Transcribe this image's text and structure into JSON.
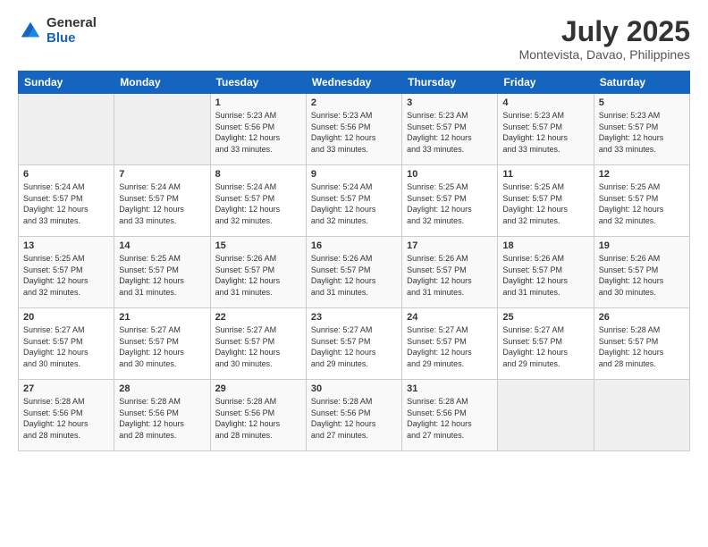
{
  "header": {
    "logo_general": "General",
    "logo_blue": "Blue",
    "title": "July 2025",
    "subtitle": "Montevista, Davao, Philippines"
  },
  "calendar": {
    "days_of_week": [
      "Sunday",
      "Monday",
      "Tuesday",
      "Wednesday",
      "Thursday",
      "Friday",
      "Saturday"
    ],
    "weeks": [
      [
        {
          "day": "",
          "info": ""
        },
        {
          "day": "",
          "info": ""
        },
        {
          "day": "1",
          "info": "Sunrise: 5:23 AM\nSunset: 5:56 PM\nDaylight: 12 hours\nand 33 minutes."
        },
        {
          "day": "2",
          "info": "Sunrise: 5:23 AM\nSunset: 5:56 PM\nDaylight: 12 hours\nand 33 minutes."
        },
        {
          "day": "3",
          "info": "Sunrise: 5:23 AM\nSunset: 5:57 PM\nDaylight: 12 hours\nand 33 minutes."
        },
        {
          "day": "4",
          "info": "Sunrise: 5:23 AM\nSunset: 5:57 PM\nDaylight: 12 hours\nand 33 minutes."
        },
        {
          "day": "5",
          "info": "Sunrise: 5:23 AM\nSunset: 5:57 PM\nDaylight: 12 hours\nand 33 minutes."
        }
      ],
      [
        {
          "day": "6",
          "info": "Sunrise: 5:24 AM\nSunset: 5:57 PM\nDaylight: 12 hours\nand 33 minutes."
        },
        {
          "day": "7",
          "info": "Sunrise: 5:24 AM\nSunset: 5:57 PM\nDaylight: 12 hours\nand 33 minutes."
        },
        {
          "day": "8",
          "info": "Sunrise: 5:24 AM\nSunset: 5:57 PM\nDaylight: 12 hours\nand 32 minutes."
        },
        {
          "day": "9",
          "info": "Sunrise: 5:24 AM\nSunset: 5:57 PM\nDaylight: 12 hours\nand 32 minutes."
        },
        {
          "day": "10",
          "info": "Sunrise: 5:25 AM\nSunset: 5:57 PM\nDaylight: 12 hours\nand 32 minutes."
        },
        {
          "day": "11",
          "info": "Sunrise: 5:25 AM\nSunset: 5:57 PM\nDaylight: 12 hours\nand 32 minutes."
        },
        {
          "day": "12",
          "info": "Sunrise: 5:25 AM\nSunset: 5:57 PM\nDaylight: 12 hours\nand 32 minutes."
        }
      ],
      [
        {
          "day": "13",
          "info": "Sunrise: 5:25 AM\nSunset: 5:57 PM\nDaylight: 12 hours\nand 32 minutes."
        },
        {
          "day": "14",
          "info": "Sunrise: 5:25 AM\nSunset: 5:57 PM\nDaylight: 12 hours\nand 31 minutes."
        },
        {
          "day": "15",
          "info": "Sunrise: 5:26 AM\nSunset: 5:57 PM\nDaylight: 12 hours\nand 31 minutes."
        },
        {
          "day": "16",
          "info": "Sunrise: 5:26 AM\nSunset: 5:57 PM\nDaylight: 12 hours\nand 31 minutes."
        },
        {
          "day": "17",
          "info": "Sunrise: 5:26 AM\nSunset: 5:57 PM\nDaylight: 12 hours\nand 31 minutes."
        },
        {
          "day": "18",
          "info": "Sunrise: 5:26 AM\nSunset: 5:57 PM\nDaylight: 12 hours\nand 31 minutes."
        },
        {
          "day": "19",
          "info": "Sunrise: 5:26 AM\nSunset: 5:57 PM\nDaylight: 12 hours\nand 30 minutes."
        }
      ],
      [
        {
          "day": "20",
          "info": "Sunrise: 5:27 AM\nSunset: 5:57 PM\nDaylight: 12 hours\nand 30 minutes."
        },
        {
          "day": "21",
          "info": "Sunrise: 5:27 AM\nSunset: 5:57 PM\nDaylight: 12 hours\nand 30 minutes."
        },
        {
          "day": "22",
          "info": "Sunrise: 5:27 AM\nSunset: 5:57 PM\nDaylight: 12 hours\nand 30 minutes."
        },
        {
          "day": "23",
          "info": "Sunrise: 5:27 AM\nSunset: 5:57 PM\nDaylight: 12 hours\nand 29 minutes."
        },
        {
          "day": "24",
          "info": "Sunrise: 5:27 AM\nSunset: 5:57 PM\nDaylight: 12 hours\nand 29 minutes."
        },
        {
          "day": "25",
          "info": "Sunrise: 5:27 AM\nSunset: 5:57 PM\nDaylight: 12 hours\nand 29 minutes."
        },
        {
          "day": "26",
          "info": "Sunrise: 5:28 AM\nSunset: 5:57 PM\nDaylight: 12 hours\nand 28 minutes."
        }
      ],
      [
        {
          "day": "27",
          "info": "Sunrise: 5:28 AM\nSunset: 5:56 PM\nDaylight: 12 hours\nand 28 minutes."
        },
        {
          "day": "28",
          "info": "Sunrise: 5:28 AM\nSunset: 5:56 PM\nDaylight: 12 hours\nand 28 minutes."
        },
        {
          "day": "29",
          "info": "Sunrise: 5:28 AM\nSunset: 5:56 PM\nDaylight: 12 hours\nand 28 minutes."
        },
        {
          "day": "30",
          "info": "Sunrise: 5:28 AM\nSunset: 5:56 PM\nDaylight: 12 hours\nand 27 minutes."
        },
        {
          "day": "31",
          "info": "Sunrise: 5:28 AM\nSunset: 5:56 PM\nDaylight: 12 hours\nand 27 minutes."
        },
        {
          "day": "",
          "info": ""
        },
        {
          "day": "",
          "info": ""
        }
      ]
    ]
  }
}
